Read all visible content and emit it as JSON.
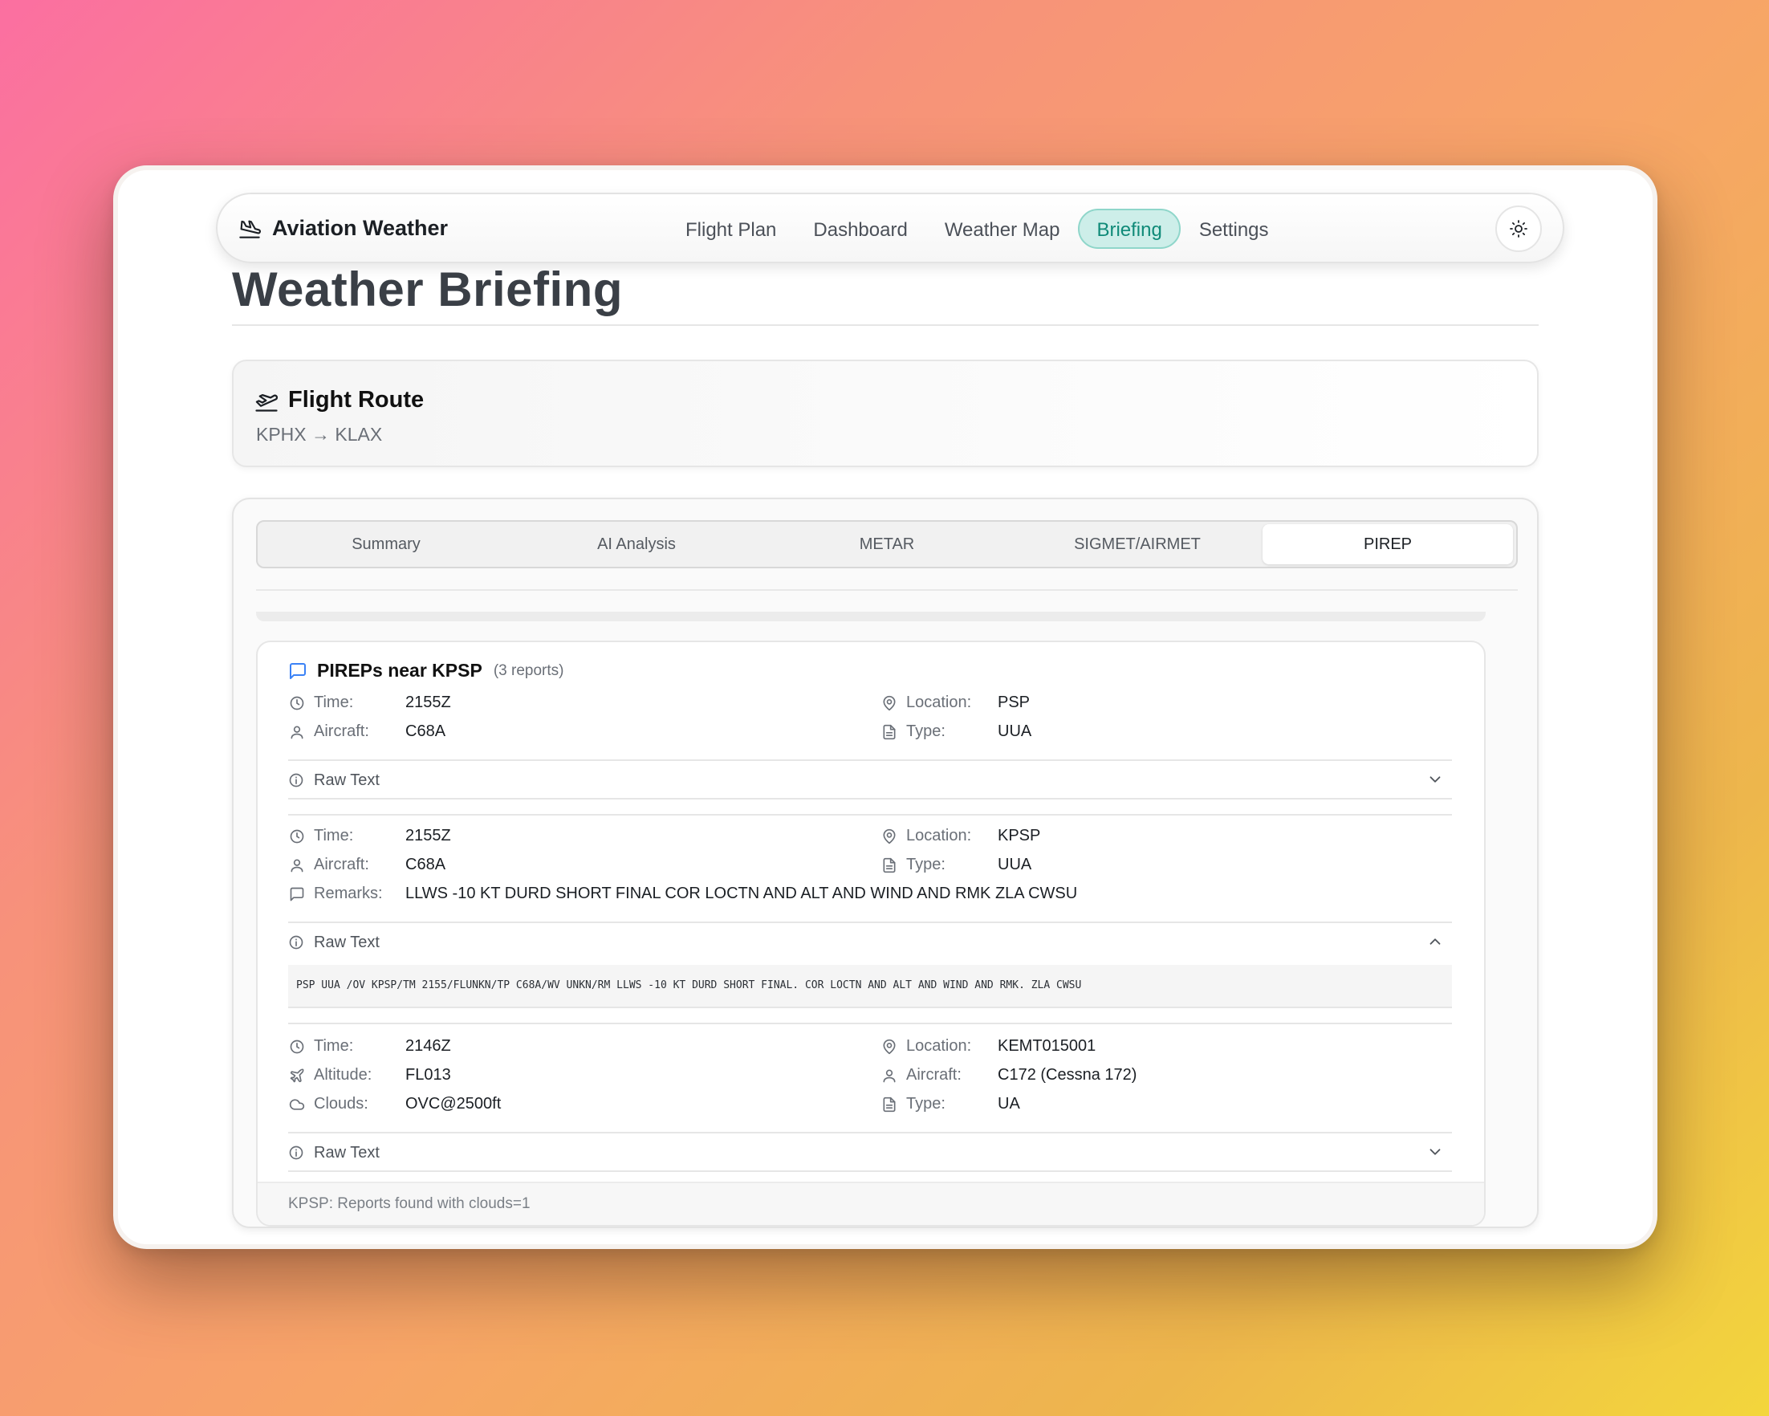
{
  "nav": {
    "brand": "Aviation Weather",
    "links": [
      "Flight Plan",
      "Dashboard",
      "Weather Map",
      "Briefing",
      "Settings"
    ],
    "active": "Briefing"
  },
  "page": {
    "title": "Weather Briefing"
  },
  "route": {
    "title": "Flight Route",
    "path": "KPHX → KLAX"
  },
  "tabs": [
    "Summary",
    "AI Analysis",
    "METAR",
    "SIGMET/AIRMET",
    "PIREP"
  ],
  "active_tab": "PIREP",
  "pirep": {
    "title": "PIREPs near KPSP",
    "count": "(3 reports)",
    "raw_label": "Raw Text",
    "reports": [
      {
        "time_label": "Time:",
        "time": "2155Z",
        "location_label": "Location:",
        "location": "PSP",
        "aircraft_label": "Aircraft:",
        "aircraft": "C68A",
        "type_label": "Type:",
        "type": "UUA"
      },
      {
        "time_label": "Time:",
        "time": "2155Z",
        "location_label": "Location:",
        "location": "KPSP",
        "aircraft_label": "Aircraft:",
        "aircraft": "C68A",
        "type_label": "Type:",
        "type": "UUA",
        "remarks_label": "Remarks:",
        "remarks": "LLWS -10 KT DURD SHORT FINAL COR LOCTN AND ALT AND WIND AND RMK ZLA CWSU",
        "raw_text": "PSP UUA /OV KPSP/TM 2155/FLUNKN/TP C68A/WV UNKN/RM LLWS -10 KT DURD SHORT FINAL. COR LOCTN AND ALT AND WIND AND RMK. ZLA CWSU"
      },
      {
        "time_label": "Time:",
        "time": "2146Z",
        "location_label": "Location:",
        "location": "KEMT015001",
        "altitude_label": "Altitude:",
        "altitude": "FL013",
        "aircraft_label": "Aircraft:",
        "aircraft": "C172 (Cessna 172)",
        "clouds_label": "Clouds:",
        "clouds": "OVC@2500ft",
        "type_label": "Type:",
        "type": "UA"
      }
    ],
    "footer": "KPSP: Reports found with clouds=1"
  },
  "colors": {
    "accent": "#0f8a78",
    "accent_bg": "#cdeee9",
    "icon_blue": "#3b82f6"
  },
  "icons": {
    "brand": "plane-landing-icon",
    "theme": "sun-icon",
    "route": "plane-departure-icon",
    "pirep": "message-square-icon"
  }
}
